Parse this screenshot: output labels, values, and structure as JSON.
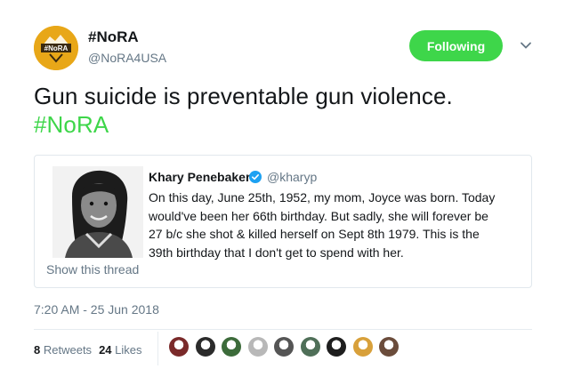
{
  "author": {
    "name": "#NoRA",
    "handle": "@NoRA4USA",
    "avatar_text": "#NoRA",
    "follow_button_label": "Following"
  },
  "tweet": {
    "text": "Gun suicide is preventable gun violence.",
    "hashtag": "#NoRA",
    "timestamp": "7:20 AM - 25 Jun 2018"
  },
  "quoted_tweet": {
    "author_name": "Khary Penebaker",
    "author_handle": "@kharyp",
    "text": "On this day, June 25th, 1952, my mom, Joyce was born. Today would've been her 66th birthday. But sadly, she will forever be 27 b/c she shot & killed herself on Sept 8th 1979. This is the 39th birthday that I don't get to spend with her.",
    "show_thread_label": "Show this thread"
  },
  "stats": {
    "retweets_count": "8",
    "retweets_label": "Retweets",
    "likes_count": "24",
    "likes_label": "Likes"
  },
  "colors": {
    "accent_green": "#3ed64a",
    "verified_blue": "#1da1f2",
    "avatar_gold": "#e8a718",
    "secondary_text": "#657786"
  },
  "liker_avatars": [
    {
      "icon": "avatar-1",
      "color": "#7a2a2a"
    },
    {
      "icon": "avatar-2",
      "color": "#2b2b2b"
    },
    {
      "icon": "avatar-3",
      "color": "#3c6b3a"
    },
    {
      "icon": "avatar-4",
      "color": "#b8b8b8"
    },
    {
      "icon": "avatar-5",
      "color": "#555555"
    },
    {
      "icon": "avatar-6",
      "color": "#4f6f58"
    },
    {
      "icon": "avatar-7",
      "color": "#1e1e1e"
    },
    {
      "icon": "avatar-8",
      "color": "#d8a03a"
    },
    {
      "icon": "avatar-9",
      "color": "#6b4c3b"
    }
  ]
}
